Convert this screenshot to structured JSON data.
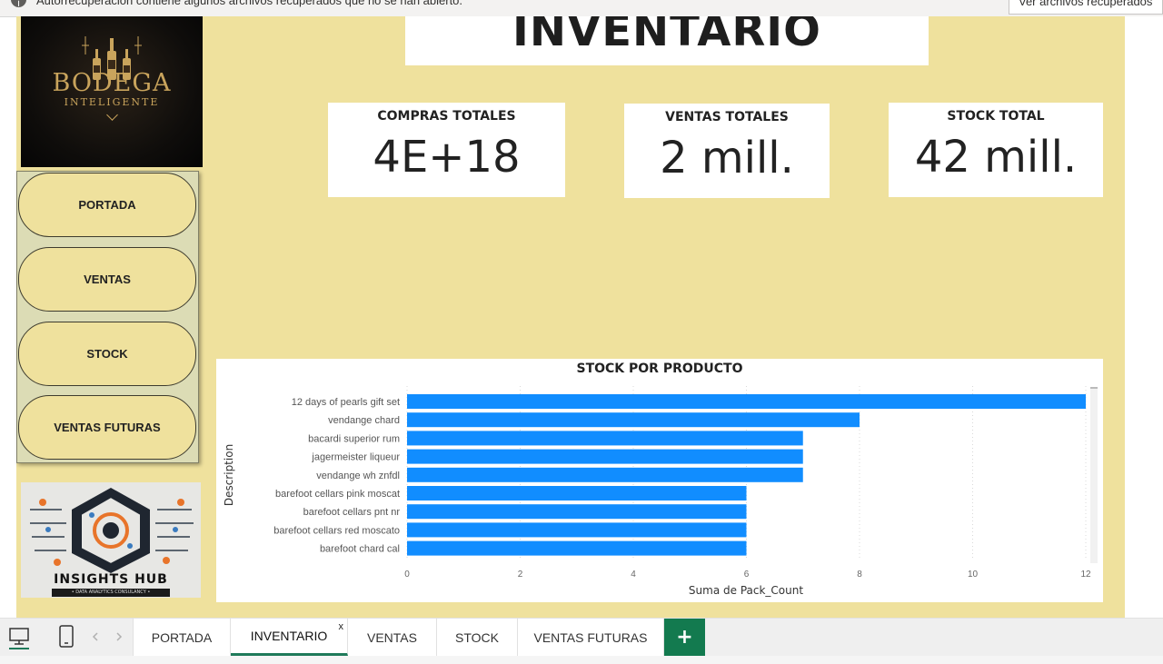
{
  "notification": {
    "message": "Autorrecuperación contiene algunos archivos recuperados que no se han abierto.",
    "button": "Ver archivos recuperados"
  },
  "logo": {
    "name": "BODEGA",
    "tagline": "INTELIGENTE"
  },
  "nav": {
    "items": [
      {
        "label": "PORTADA"
      },
      {
        "label": "VENTAS"
      },
      {
        "label": "STOCK"
      },
      {
        "label": "VENTAS FUTURAS"
      }
    ]
  },
  "insights_logo": {
    "name": "INSIGHTS HUB",
    "tagline": "• DATA ANALYTICS CONSULANCY •"
  },
  "page_title": "INVENTARIO",
  "cards": [
    {
      "title": "COMPRAS TOTALES",
      "value": "4E+18"
    },
    {
      "title": "VENTAS TOTALES",
      "value": "2 mill."
    },
    {
      "title": "STOCK TOTAL",
      "value": "42 mill."
    }
  ],
  "chart_data": {
    "type": "bar",
    "orientation": "horizontal",
    "title": "STOCK POR PRODUCTO",
    "xlabel": "Suma de Pack_Count",
    "ylabel": "Description",
    "categories": [
      "12 days of pearls gift set",
      "vendange chard",
      "bacardi superior rum",
      "jagermeister liqueur",
      "vendange wh znfdl",
      "barefoot cellars pink moscat",
      "barefoot cellars pnt nr",
      "barefoot cellars red moscato",
      "barefoot chard cal"
    ],
    "values": [
      12,
      8,
      7,
      7,
      7,
      6,
      6,
      6,
      6
    ],
    "xticks": [
      0,
      2,
      4,
      6,
      8,
      10,
      12
    ],
    "xlim": [
      0,
      12
    ],
    "grid": true,
    "bar_color": "#118dff"
  },
  "tabs": [
    {
      "label": "PORTADA"
    },
    {
      "label": "INVENTARIO",
      "close": "x"
    },
    {
      "label": "VENTAS"
    },
    {
      "label": "STOCK"
    },
    {
      "label": "VENTAS FUTURAS"
    }
  ],
  "add_tab": "+",
  "colors": {
    "canvas": "#efe19d",
    "accent": "#137a4f"
  }
}
